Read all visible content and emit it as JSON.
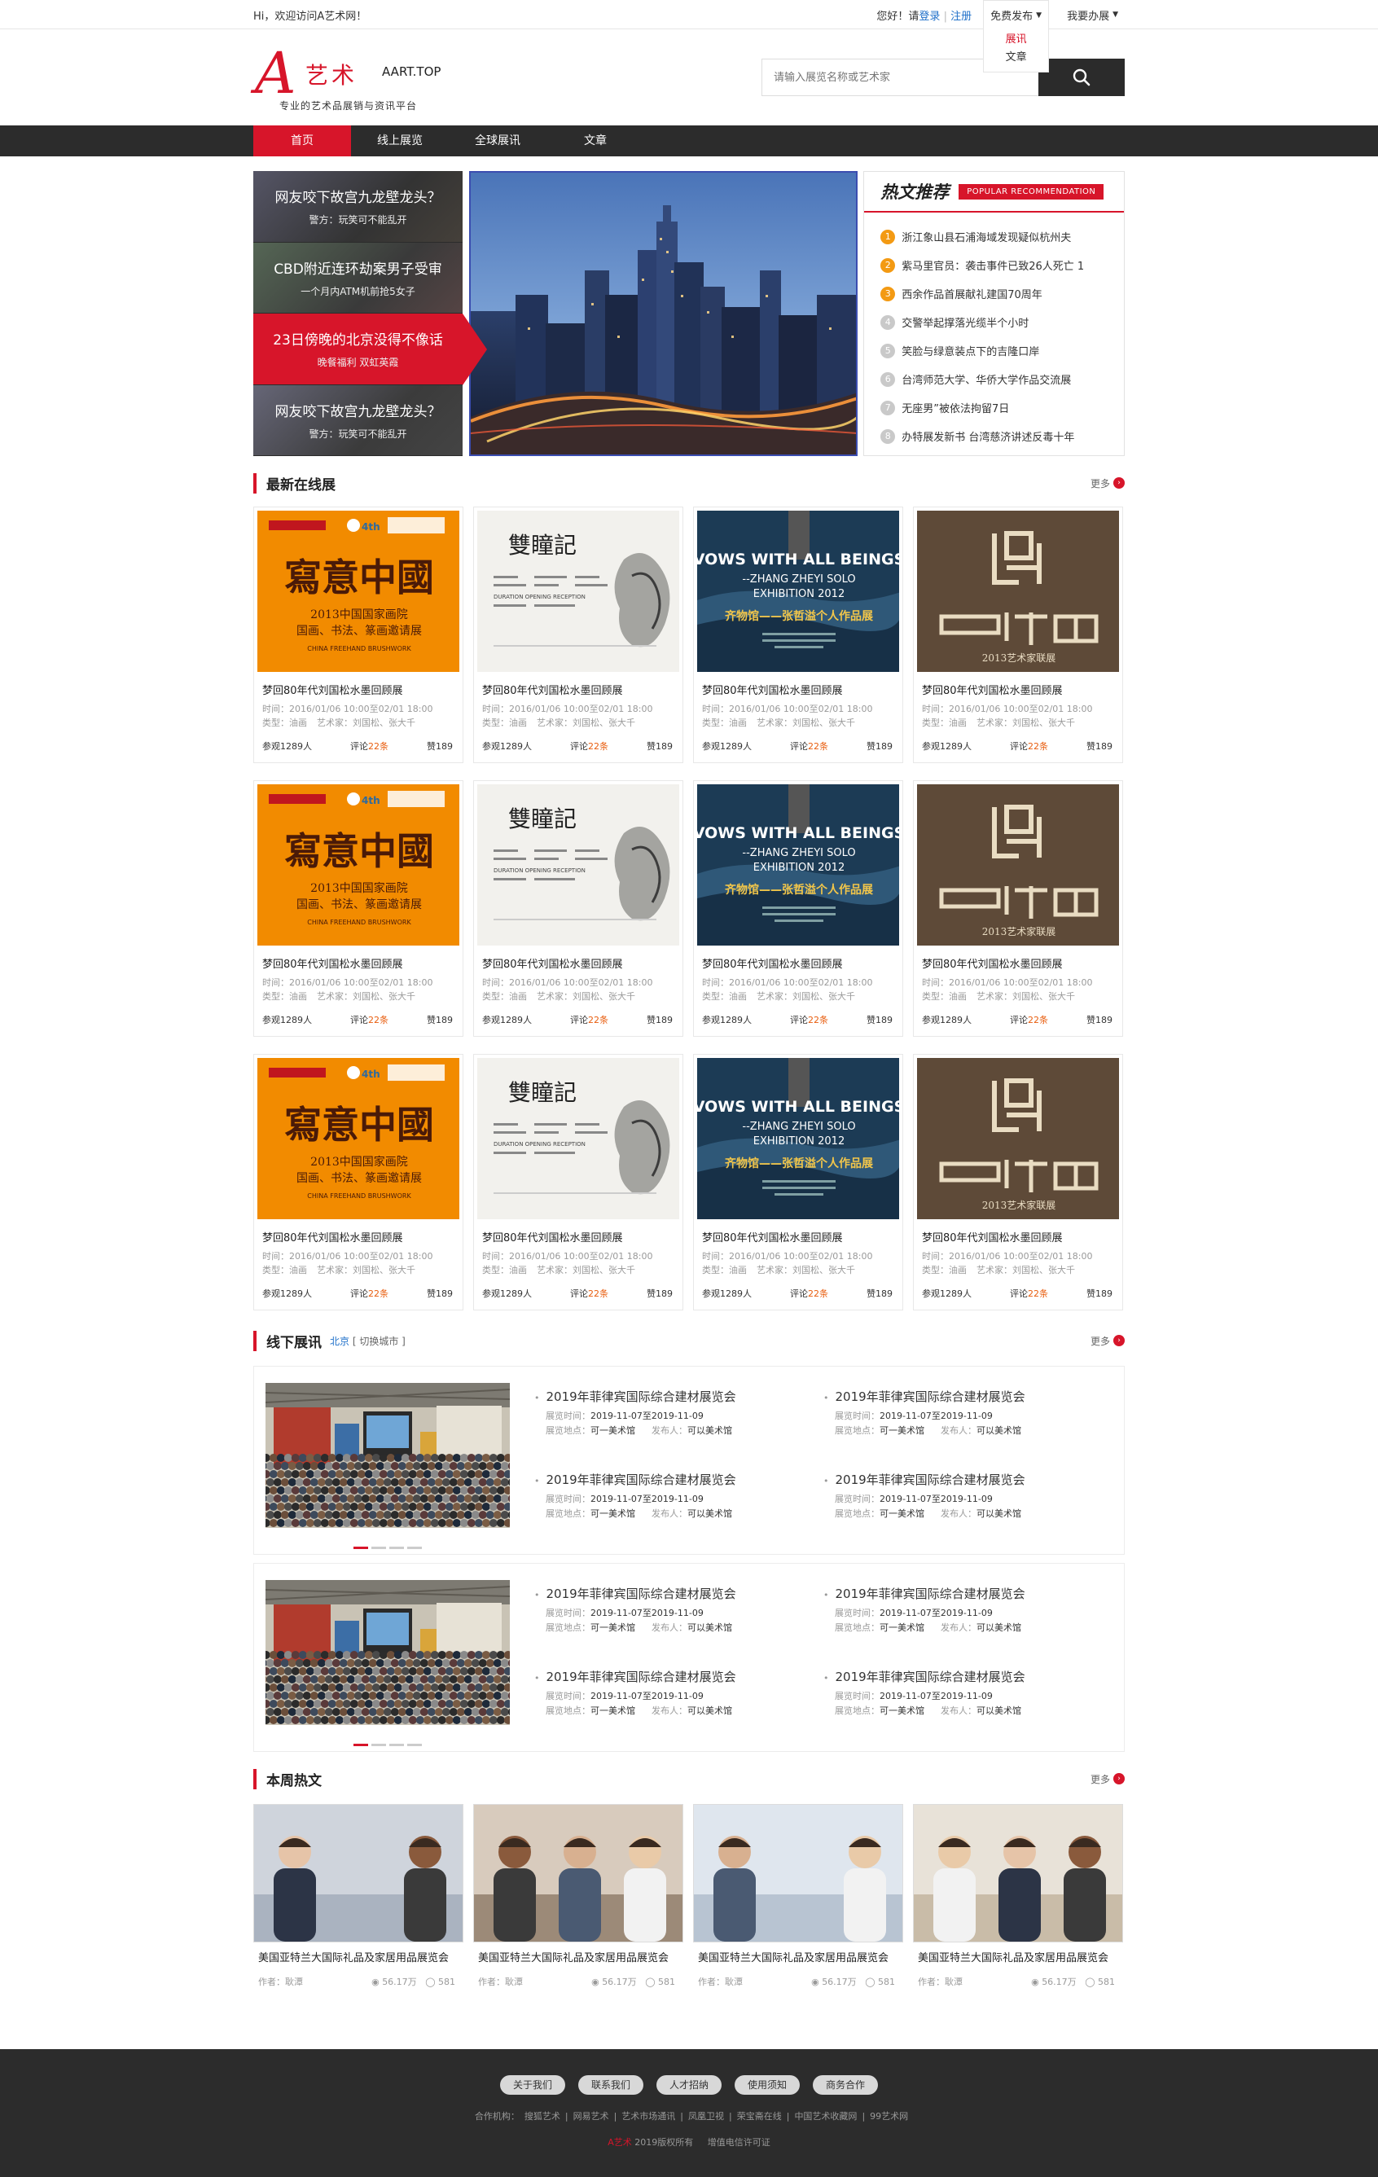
{
  "topbar": {
    "welcome": "Hi，欢迎访问A艺术网！",
    "hello": "您好！请",
    "login": "登录",
    "sep": "|",
    "register": "注册",
    "publish": "免费发布",
    "publish_menu": [
      "展讯",
      "文章"
    ],
    "exhibit": "我要办展"
  },
  "logo": {
    "a": "A",
    "yishu": "艺术",
    "domain": "AART.TOP",
    "slogan": "专业的艺术品展销与资讯平台"
  },
  "search": {
    "placeholder": "请输入展览名称或艺术家"
  },
  "nav": [
    "首页",
    "线上展览",
    "全球展讯",
    "文章"
  ],
  "banner": {
    "tiles": [
      {
        "title": "网友咬下故宫九龙壁龙头？",
        "sub": "警方：玩笑可不能乱开"
      },
      {
        "title": "CBD附近连环劫案男子受审",
        "sub": "一个月内ATM机前抢5女子"
      },
      {
        "title": "23日傍晚的北京没得不像话",
        "sub": "晚餐福利 双虹英霞"
      },
      {
        "title": "网友咬下故宫九龙壁龙头？",
        "sub": "警方：玩笑可不能乱开"
      }
    ]
  },
  "hot": {
    "title": "热文推荐",
    "title_en": "POPULAR RECOMMENDATION",
    "items": [
      "浙江象山县石浦海域发现疑似杭州夫",
      "紫马里官员：袭击事件已致26人死亡 1",
      "西余作品首展献礼建国70周年",
      "交警举起撑落光缆半个小时",
      "笑脸与绿意装点下的吉隆口岸",
      "台湾师范大学、华侨大学作品交流展",
      "无座男”被依法拘留7日",
      "办特展发新书 台湾慈济讲述反毒十年"
    ],
    "rank_colors": [
      "#f39a13",
      "#f39a13",
      "#f39a13",
      "#c9c9c9",
      "#c9c9c9",
      "#c9c9c9",
      "#c9c9c9",
      "#c9c9c9"
    ]
  },
  "online": {
    "title": "最新在线展",
    "more": "更多",
    "card": {
      "title": "梦回80年代刘国松水墨回顾展",
      "time": "时间：2016/01/06 10:00至02/01 18:00",
      "type": "类型：油画",
      "artist": "艺术家：刘国松、张大千",
      "views": "参观1289人",
      "comments_pre": "评论",
      "comments_num": "22条",
      "likes": "赞189"
    },
    "posters": [
      {
        "kind": "orange",
        "big": "寫意中國",
        "line1": "2013中国国家画院",
        "line2": "国画、书法、篆画邀请展",
        "en": "CHINA FREEHAND BRUSHWORK",
        "badge": "4th"
      },
      {
        "kind": "paper",
        "big": "雙瞳記",
        "small": "DURATION  OPENING RECEPTION"
      },
      {
        "kind": "navy",
        "en1": "VOWS WITH ALL BEINGS",
        "en2": "--ZHANG ZHEYI SOLO",
        "en3": "EXHIBITION 2012",
        "cn": "齐物馆——张哲溢个人作品展"
      },
      {
        "kind": "brown",
        "cn": "2013艺术家联展"
      }
    ]
  },
  "offline": {
    "title": "线下展讯",
    "city": "北京",
    "switch": "[ 切换城市 ]",
    "more": "更多",
    "item": {
      "title": "2019年菲律宾国际综合建材展览会",
      "time_label": "展览时间：",
      "time": "2019-11-07至2019-11-09",
      "place_label": "展览地点：",
      "place": "可一美术馆",
      "pub_label": "发布人：",
      "pub": "可以美术馆"
    }
  },
  "weekly": {
    "title": "本周热文",
    "more": "更多",
    "card": {
      "title": "美国亚特兰大国际礼品及家居用品展览会",
      "author": "作者：耿潭",
      "views": "56.17万",
      "comments": "581"
    }
  },
  "footer": {
    "buttons": [
      "关于我们",
      "联系我们",
      "人才招纳",
      "使用须知",
      "商务合作"
    ],
    "partners_label": "合作机构：",
    "partners": [
      "搜狐艺术",
      "网易艺术",
      "艺术市场通讯",
      "凤凰卫视",
      "荣宝斋在线",
      "中国艺术收藏网",
      "99艺术网"
    ],
    "copy_brand": "A艺术",
    "copy_text": "2019版权所有",
    "license": "增值电信许可证"
  },
  "colors": {
    "accent": "#d7152a",
    "dark": "#2c2c2c",
    "link": "#1e6fc9",
    "orange_text": "#e85c0d"
  }
}
